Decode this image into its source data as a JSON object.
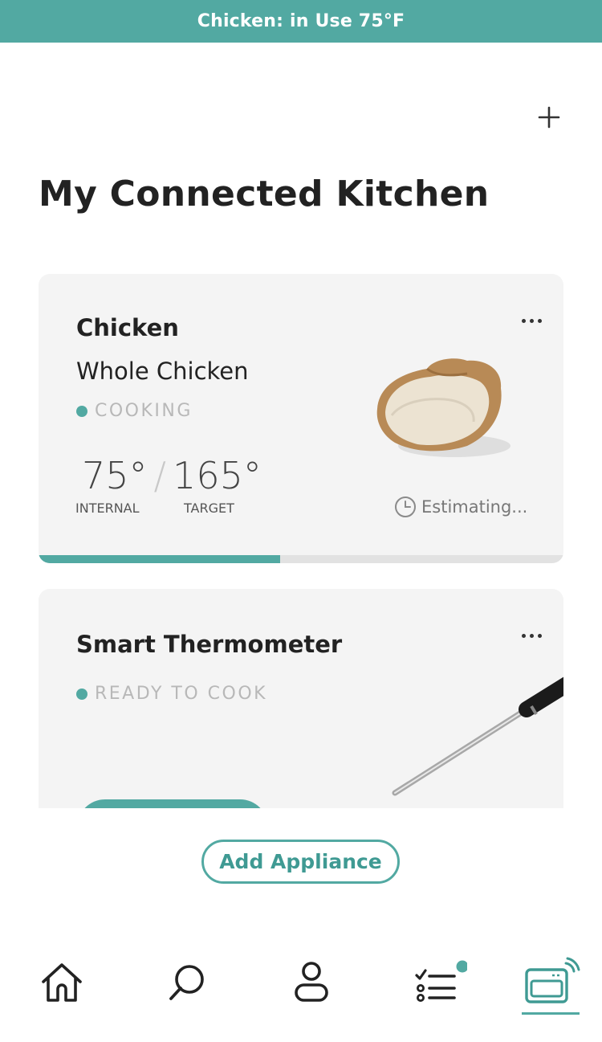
{
  "status_bar": {
    "text": "Chicken: in Use 75°F"
  },
  "page": {
    "title": "My Connected Kitchen"
  },
  "cards": [
    {
      "title": "Chicken",
      "subtitle": "Whole Chicken",
      "status": "COOKING",
      "internal_temp": "75°",
      "target_temp": "165°",
      "internal_label": "INTERNAL",
      "target_label": "TARGET",
      "estimate": "Estimating...",
      "progress": 0.46
    },
    {
      "title": "Smart Thermometer",
      "status": "READY TO COOK"
    }
  ],
  "actions": {
    "add_appliance": "Add Appliance"
  },
  "nav": {
    "items": [
      "home",
      "search",
      "profile",
      "checklist",
      "appliances"
    ],
    "active": "appliances"
  },
  "colors": {
    "accent": "#52a9a2",
    "card_bg": "#f4f4f4",
    "muted": "#b8b8b8"
  }
}
